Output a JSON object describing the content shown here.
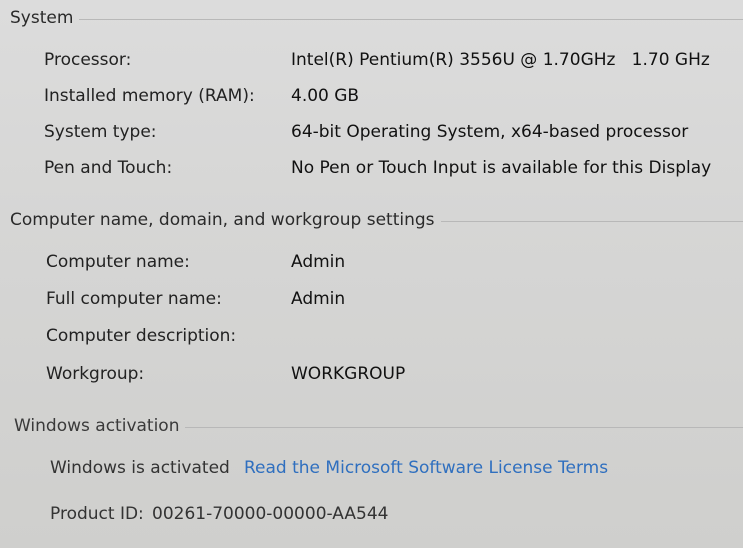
{
  "system": {
    "title": "System",
    "rows": [
      {
        "label": "Processor:",
        "value": "Intel(R) Pentium(R) 3556U @ 1.70GHz   1.70 GHz"
      },
      {
        "label": "Installed memory (RAM):",
        "value": "4.00 GB"
      },
      {
        "label": "System type:",
        "value": "64-bit Operating System, x64-based processor"
      },
      {
        "label": "Pen and Touch:",
        "value": "No Pen or Touch Input is available for this Display"
      }
    ]
  },
  "computer": {
    "title": "Computer name, domain, and workgroup settings",
    "rows": [
      {
        "label": "Computer name:",
        "value": "Admin"
      },
      {
        "label": "Full computer name:",
        "value": "Admin"
      },
      {
        "label": "Computer description:",
        "value": ""
      },
      {
        "label": "Workgroup:",
        "value": "WORKGROUP"
      }
    ]
  },
  "activation": {
    "title": "Windows activation",
    "status": "Windows is activated",
    "license_link": "Read the Microsoft Software License Terms",
    "product_id_label": "Product ID:",
    "product_id": "00261-70000-00000-AA544"
  },
  "colors": {
    "link": "#2f6fbf",
    "background": "#d6d6d5"
  }
}
